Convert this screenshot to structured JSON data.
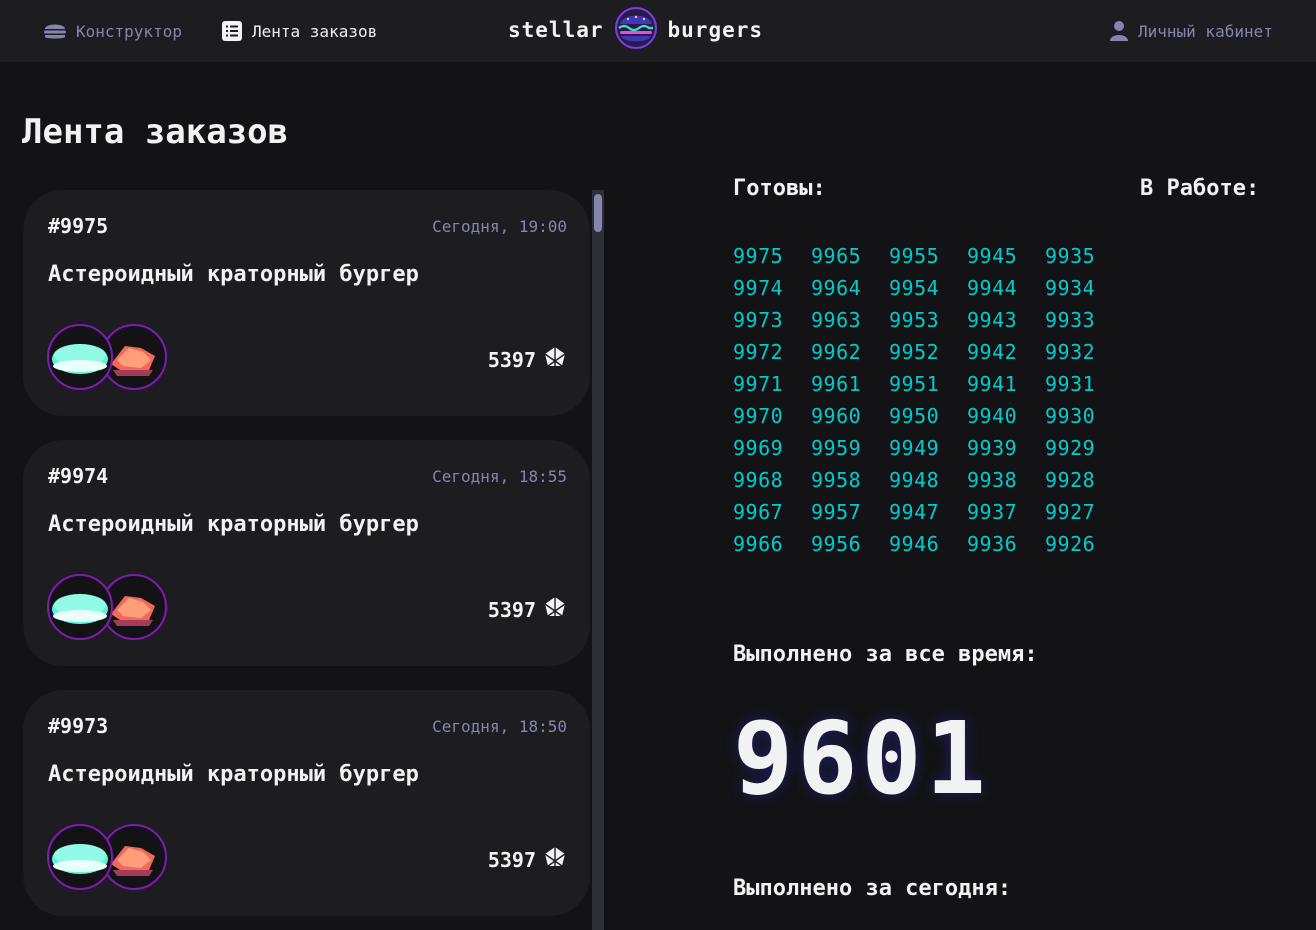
{
  "header": {
    "nav_constructor": "Конструктор",
    "nav_feed": "Лента заказов",
    "nav_account": "Личный кабинет",
    "logo_left": "stellar",
    "logo_right": "burgers"
  },
  "page": {
    "title": "Лента заказов"
  },
  "orders": [
    {
      "number": "#9975",
      "time": "Сегодня, 19:00",
      "name": "Астероидный краторный бургер",
      "price": "5397",
      "ingredients": [
        "bun-icon",
        "meat-icon"
      ]
    },
    {
      "number": "#9974",
      "time": "Сегодня, 18:55",
      "name": "Астероидный краторный бургер",
      "price": "5397",
      "ingredients": [
        "bun-icon",
        "meat-icon"
      ]
    },
    {
      "number": "#9973",
      "time": "Сегодня, 18:50",
      "name": "Астероидный краторный бургер",
      "price": "5397",
      "ingredients": [
        "bun-icon",
        "meat-icon"
      ]
    }
  ],
  "stats": {
    "ready_title": "Готовы:",
    "in_work_title": "В Работе:",
    "ready_numbers": [
      "9975",
      "9965",
      "9955",
      "9945",
      "9935",
      "9974",
      "9964",
      "9954",
      "9944",
      "9934",
      "9973",
      "9963",
      "9953",
      "9943",
      "9933",
      "9972",
      "9962",
      "9952",
      "9942",
      "9932",
      "9971",
      "9961",
      "9951",
      "9941",
      "9931",
      "9970",
      "9960",
      "9950",
      "9940",
      "9930",
      "9969",
      "9959",
      "9949",
      "9939",
      "9929",
      "9968",
      "9958",
      "9948",
      "9938",
      "9928",
      "9967",
      "9957",
      "9947",
      "9937",
      "9927",
      "9966",
      "9956",
      "9946",
      "9936",
      "9926"
    ],
    "total_label": "Выполнено за все время:",
    "total_value": "9601",
    "today_label": "Выполнено за сегодня:"
  },
  "colors": {
    "background": "#131316",
    "card": "#1C1C21",
    "accent_cyan": "#00CCCC",
    "inactive": "#8585AD",
    "ingredient_border": "#801AB2"
  }
}
